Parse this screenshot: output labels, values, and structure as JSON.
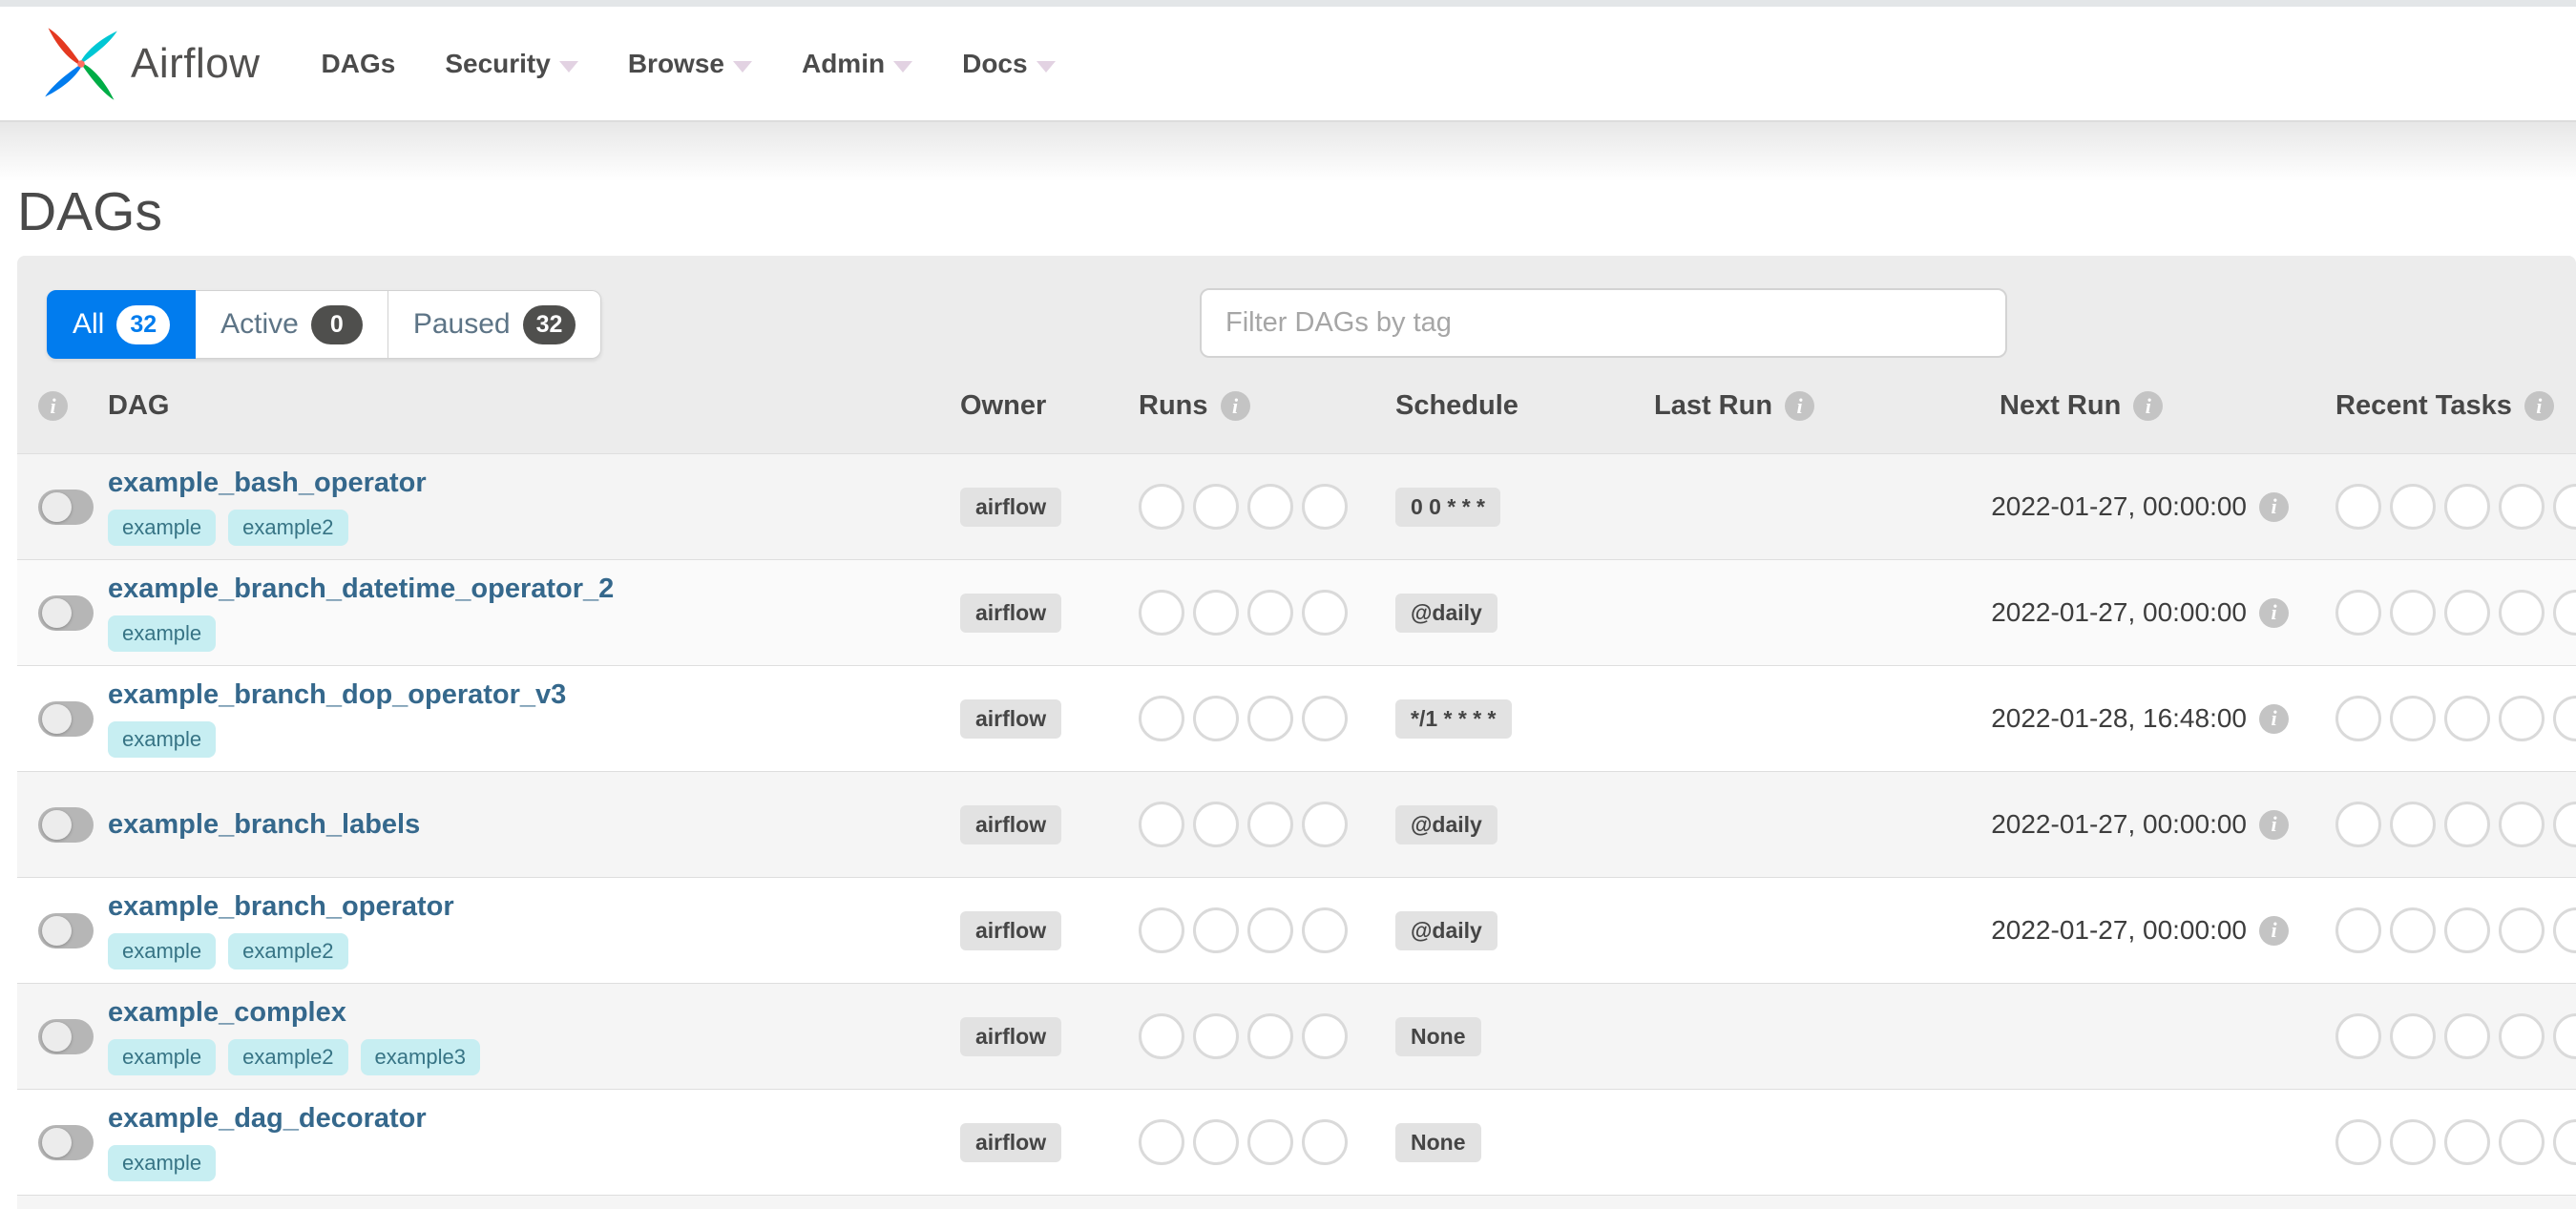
{
  "navbar": {
    "brand": "Airflow",
    "items": [
      {
        "label": "DAGs",
        "has_menu": false
      },
      {
        "label": "Security",
        "has_menu": true
      },
      {
        "label": "Browse",
        "has_menu": true
      },
      {
        "label": "Admin",
        "has_menu": true
      },
      {
        "label": "Docs",
        "has_menu": true
      }
    ]
  },
  "page": {
    "title": "DAGs"
  },
  "filters": {
    "tabs": [
      {
        "label": "All",
        "count": "32",
        "active": true
      },
      {
        "label": "Active",
        "count": "0",
        "active": false
      },
      {
        "label": "Paused",
        "count": "32",
        "active": false
      }
    ],
    "tag_filter_placeholder": "Filter DAGs by tag"
  },
  "table": {
    "columns": [
      "DAG",
      "Owner",
      "Runs",
      "Schedule",
      "Last Run",
      "Next Run",
      "Recent Tasks"
    ],
    "runs_slots": 4,
    "recent_slots": 5,
    "rows": [
      {
        "name": "example_bash_operator",
        "tags": [
          "example",
          "example2"
        ],
        "owner": "airflow",
        "schedule": "0 0 * * *",
        "last_run": "",
        "next_run": "2022-01-27, 00:00:00",
        "paused": true
      },
      {
        "name": "example_branch_datetime_operator_2",
        "tags": [
          "example"
        ],
        "owner": "airflow",
        "schedule": "@daily",
        "last_run": "",
        "next_run": "2022-01-27, 00:00:00",
        "paused": true
      },
      {
        "name": "example_branch_dop_operator_v3",
        "tags": [
          "example"
        ],
        "owner": "airflow",
        "schedule": "*/1 * * * *",
        "last_run": "",
        "next_run": "2022-01-28, 16:48:00",
        "paused": true
      },
      {
        "name": "example_branch_labels",
        "tags": [],
        "owner": "airflow",
        "schedule": "@daily",
        "last_run": "",
        "next_run": "2022-01-27, 00:00:00",
        "paused": true
      },
      {
        "name": "example_branch_operator",
        "tags": [
          "example",
          "example2"
        ],
        "owner": "airflow",
        "schedule": "@daily",
        "last_run": "",
        "next_run": "2022-01-27, 00:00:00",
        "paused": true
      },
      {
        "name": "example_complex",
        "tags": [
          "example",
          "example2",
          "example3"
        ],
        "owner": "airflow",
        "schedule": "None",
        "last_run": "",
        "next_run": "",
        "paused": true
      },
      {
        "name": "example_dag_decorator",
        "tags": [
          "example"
        ],
        "owner": "airflow",
        "schedule": "None",
        "last_run": "",
        "next_run": "",
        "paused": true
      }
    ]
  },
  "colors": {
    "brand_blue": "#017cee",
    "logo_red": "#e43921",
    "logo_cyan": "#00c7d4",
    "logo_green": "#00ad46",
    "tag_bg": "#c7eef2",
    "tag_text": "#377485",
    "badge_bg": "#e2e2e2"
  }
}
